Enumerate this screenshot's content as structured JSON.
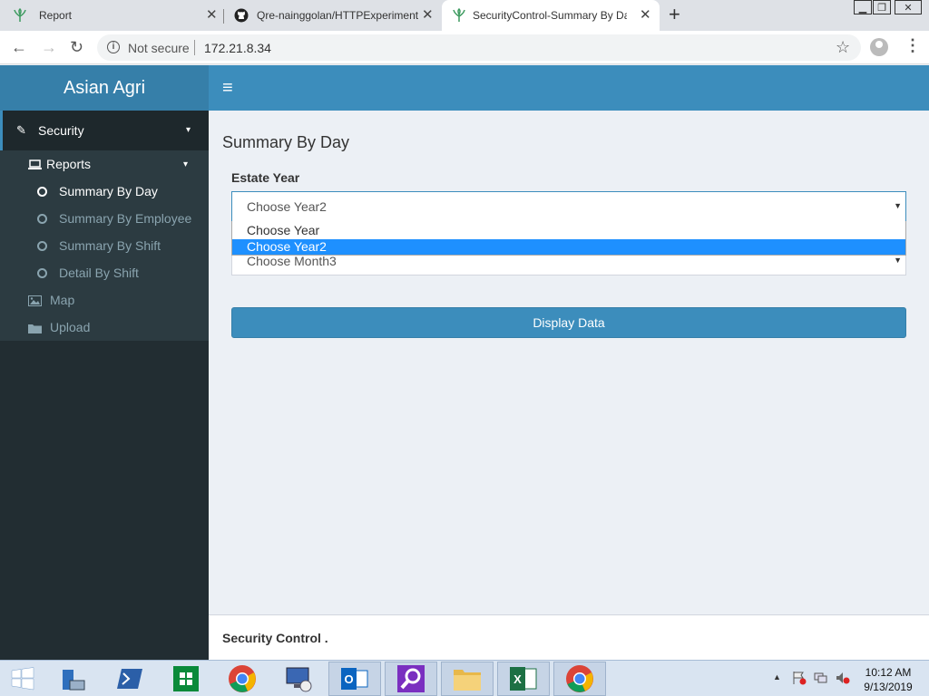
{
  "browser": {
    "tabs": [
      {
        "title": "Report"
      },
      {
        "title": "Qre-nainggolan/HTTPExperimental: E"
      },
      {
        "title": "SecurityControl-Summary By Day"
      }
    ],
    "security_label": "Not secure",
    "url": "172.21.8.34"
  },
  "app": {
    "brand": "Asian Agri",
    "sidebar": {
      "security": "Security",
      "reports": "Reports",
      "items": [
        {
          "label": "Summary By Day",
          "active": true
        },
        {
          "label": "Summary By Employee"
        },
        {
          "label": "Summary By Shift"
        },
        {
          "label": "Detail By Shift"
        }
      ],
      "map": "Map",
      "upload": "Upload"
    },
    "page_title": "Summary By Day",
    "estate_year_label": "Estate Year",
    "year_select_value": "Choose Year2",
    "month_select_value": "Choose Month3",
    "dropdown_options": [
      "Choose Year",
      "Choose Year2"
    ],
    "selected_option_index": 1,
    "display_button": "Display Data",
    "footer": "Security Control ."
  },
  "taskbar": {
    "time": "10:12 AM",
    "date": "9/13/2019"
  },
  "colors": {
    "brand": "#367fa9",
    "topbar": "#3c8dbc",
    "sidebar": "#222d32",
    "highlight": "#1e90ff"
  }
}
